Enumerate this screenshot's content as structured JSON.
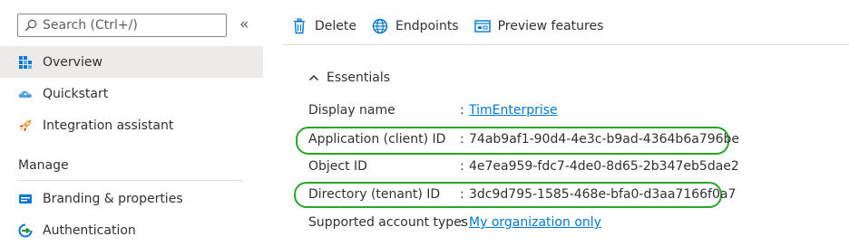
{
  "search": {
    "placeholder": "Search (Ctrl+/)",
    "collapse_glyph": "«"
  },
  "sidebar": {
    "items": [
      {
        "label": "Overview",
        "icon": "overview-grid-icon",
        "selected": true
      },
      {
        "label": "Quickstart",
        "icon": "quickstart-cloud-icon",
        "selected": false
      },
      {
        "label": "Integration assistant",
        "icon": "rocket-icon",
        "selected": false
      }
    ],
    "manage_header": "Manage",
    "manage_items": [
      {
        "label": "Branding & properties",
        "icon": "branding-card-icon"
      },
      {
        "label": "Authentication",
        "icon": "authentication-icon"
      }
    ]
  },
  "toolbar": {
    "delete_label": "Delete",
    "endpoints_label": "Endpoints",
    "preview_label": "Preview features"
  },
  "essentials": {
    "title": "Essentials",
    "properties": [
      {
        "label": "Display name",
        "colon": ":",
        "value": "TimEnterprise",
        "is_link": true
      },
      {
        "label": "Application (client) ID",
        "colon": ":",
        "value": "74ab9af1-90d4-4e3c-b9ad-4364b6a796be",
        "is_link": false
      },
      {
        "label": "Object ID",
        "colon": ":",
        "value": "4e7ea959-fdc7-4de0-8d65-2b347eb5dae2",
        "is_link": false
      },
      {
        "label": "Directory (tenant) ID",
        "colon": ":",
        "value": "3dc9d795-1585-468e-bfa0-d3aa7166f0a7",
        "is_link": false
      },
      {
        "label": "Supported account types",
        "colon": ":",
        "value": "My organization only",
        "is_link": true
      }
    ]
  },
  "colors": {
    "accent": "#0078d4",
    "selected_bg": "#edebe9",
    "highlight": "#2aa52a",
    "text": "#323130"
  }
}
